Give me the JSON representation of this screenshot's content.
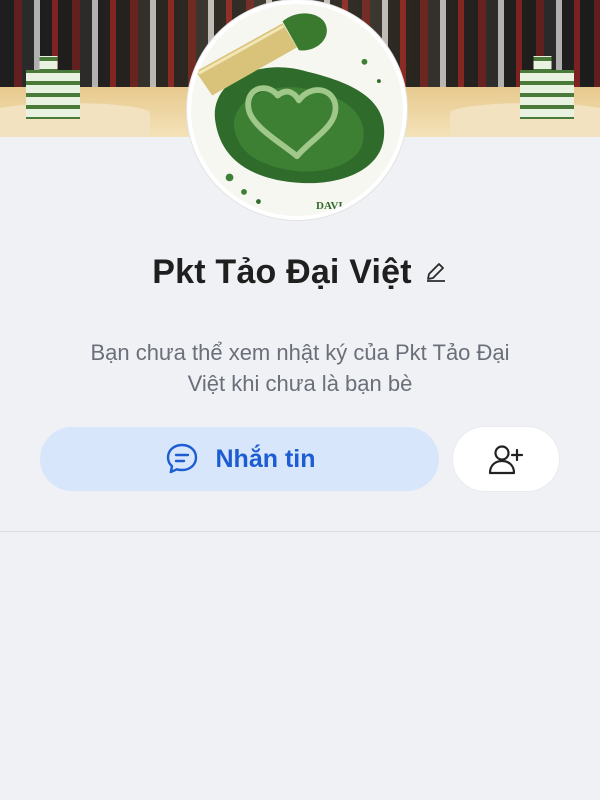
{
  "profile": {
    "name": "Pkt Tảo Đại Việt",
    "avatar_text": "DAVI",
    "notice_line1": "Bạn chưa thể xem nhật ký của Pkt Tảo Đại",
    "notice_line2": "Việt khi chưa là bạn bè"
  },
  "actions": {
    "message_label": "Nhắn tin"
  },
  "icons": {
    "edit": "pencil-icon",
    "message": "chat-bubble-icon",
    "add_friend": "add-friend-icon"
  },
  "colors": {
    "background": "#f0f1f5",
    "message_button_bg": "#d8e6fb",
    "message_button_text": "#1d5dd2",
    "name_text": "#1f1f1f",
    "notice_text": "#6a6f79"
  }
}
